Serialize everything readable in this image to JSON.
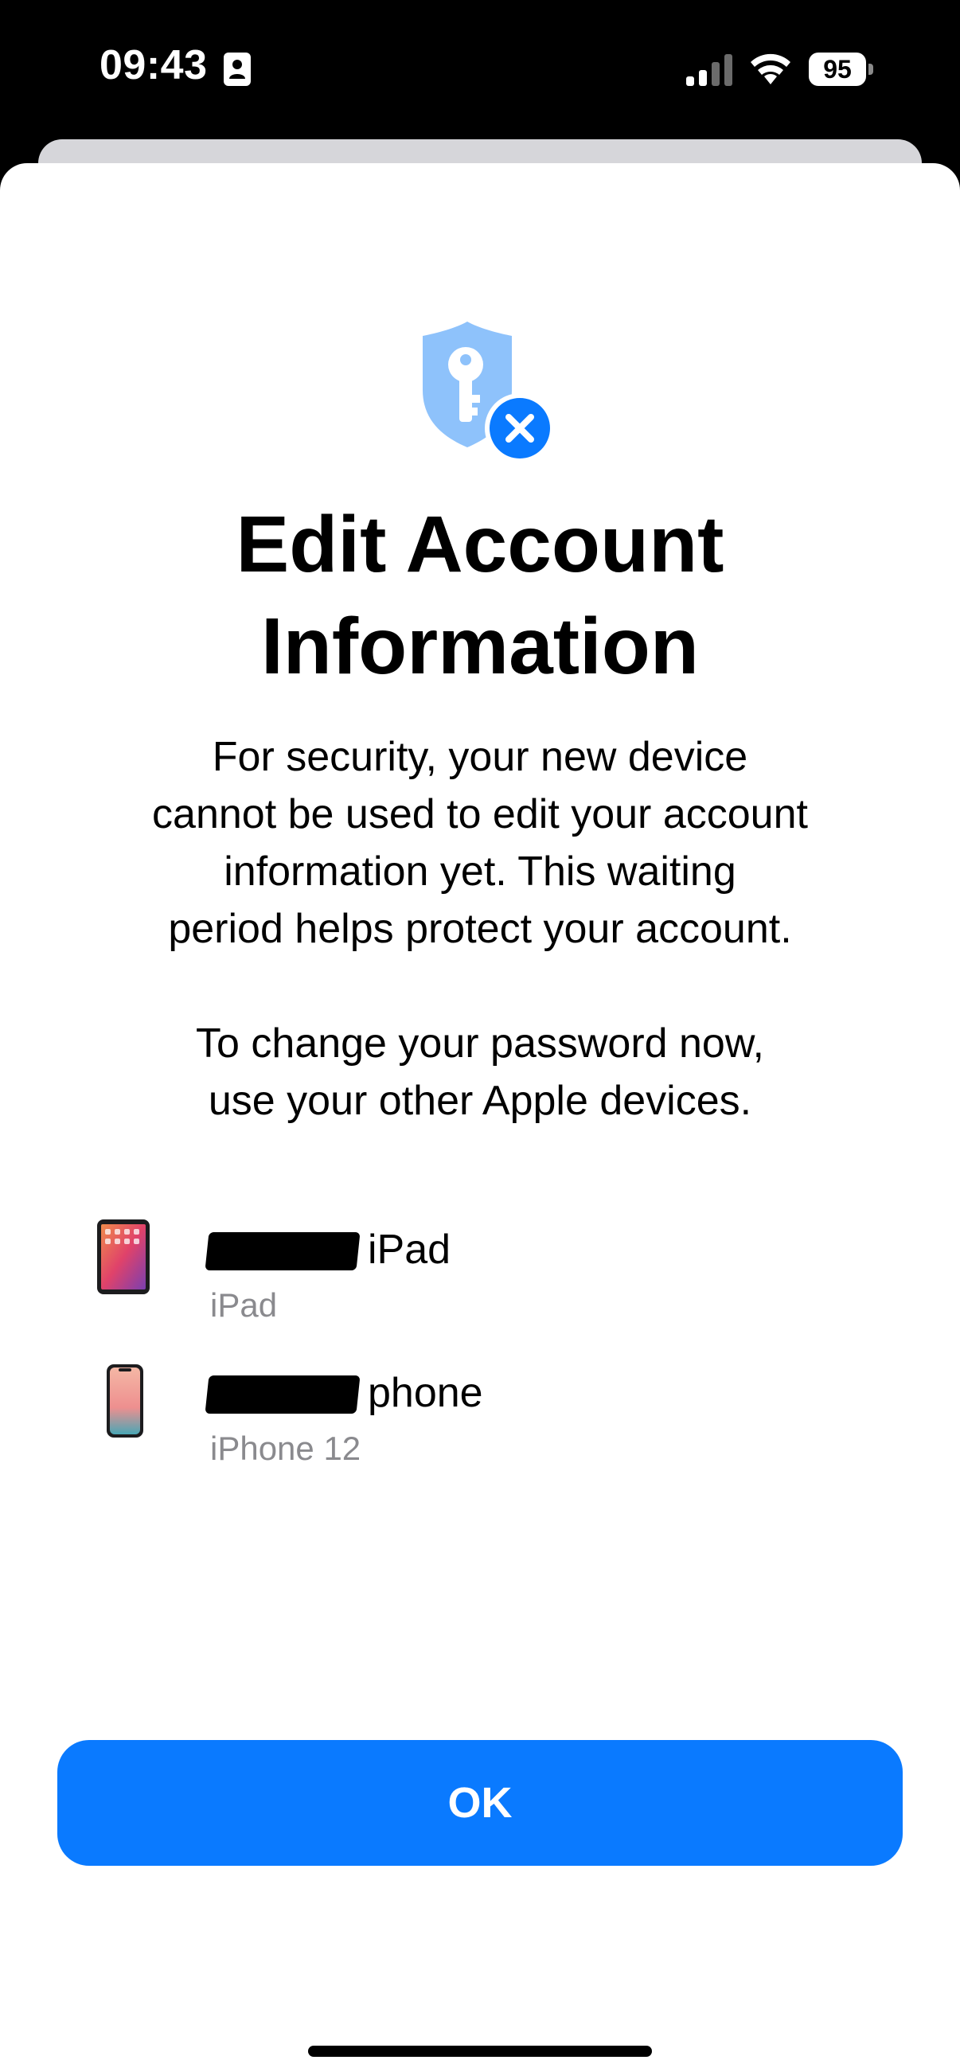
{
  "status_bar": {
    "time": "09:43",
    "battery_level": "95",
    "icons": [
      "contact-card-icon",
      "cellular-signal-icon",
      "wifi-icon",
      "battery-icon"
    ]
  },
  "hero": {
    "icon": "shield-key-x-icon",
    "accent_color": "#0a7aff",
    "shield_color": "#8ec2fb"
  },
  "title": "Edit Account\nInformation",
  "body": {
    "paragraph_1": "For security, your new device\ncannot be used to edit your account\ninformation yet. This waiting\nperiod helps protect your account.",
    "paragraph_2": "To change your password now,\nuse your other Apple devices."
  },
  "devices": [
    {
      "name_suffix": "iPad",
      "model": "iPad",
      "icon": "ipad-icon"
    },
    {
      "name_suffix": "phone",
      "model": "iPhone 12",
      "icon": "iphone-icon"
    }
  ],
  "actions": {
    "ok_label": "OK",
    "ok_color": "#0a7aff"
  }
}
